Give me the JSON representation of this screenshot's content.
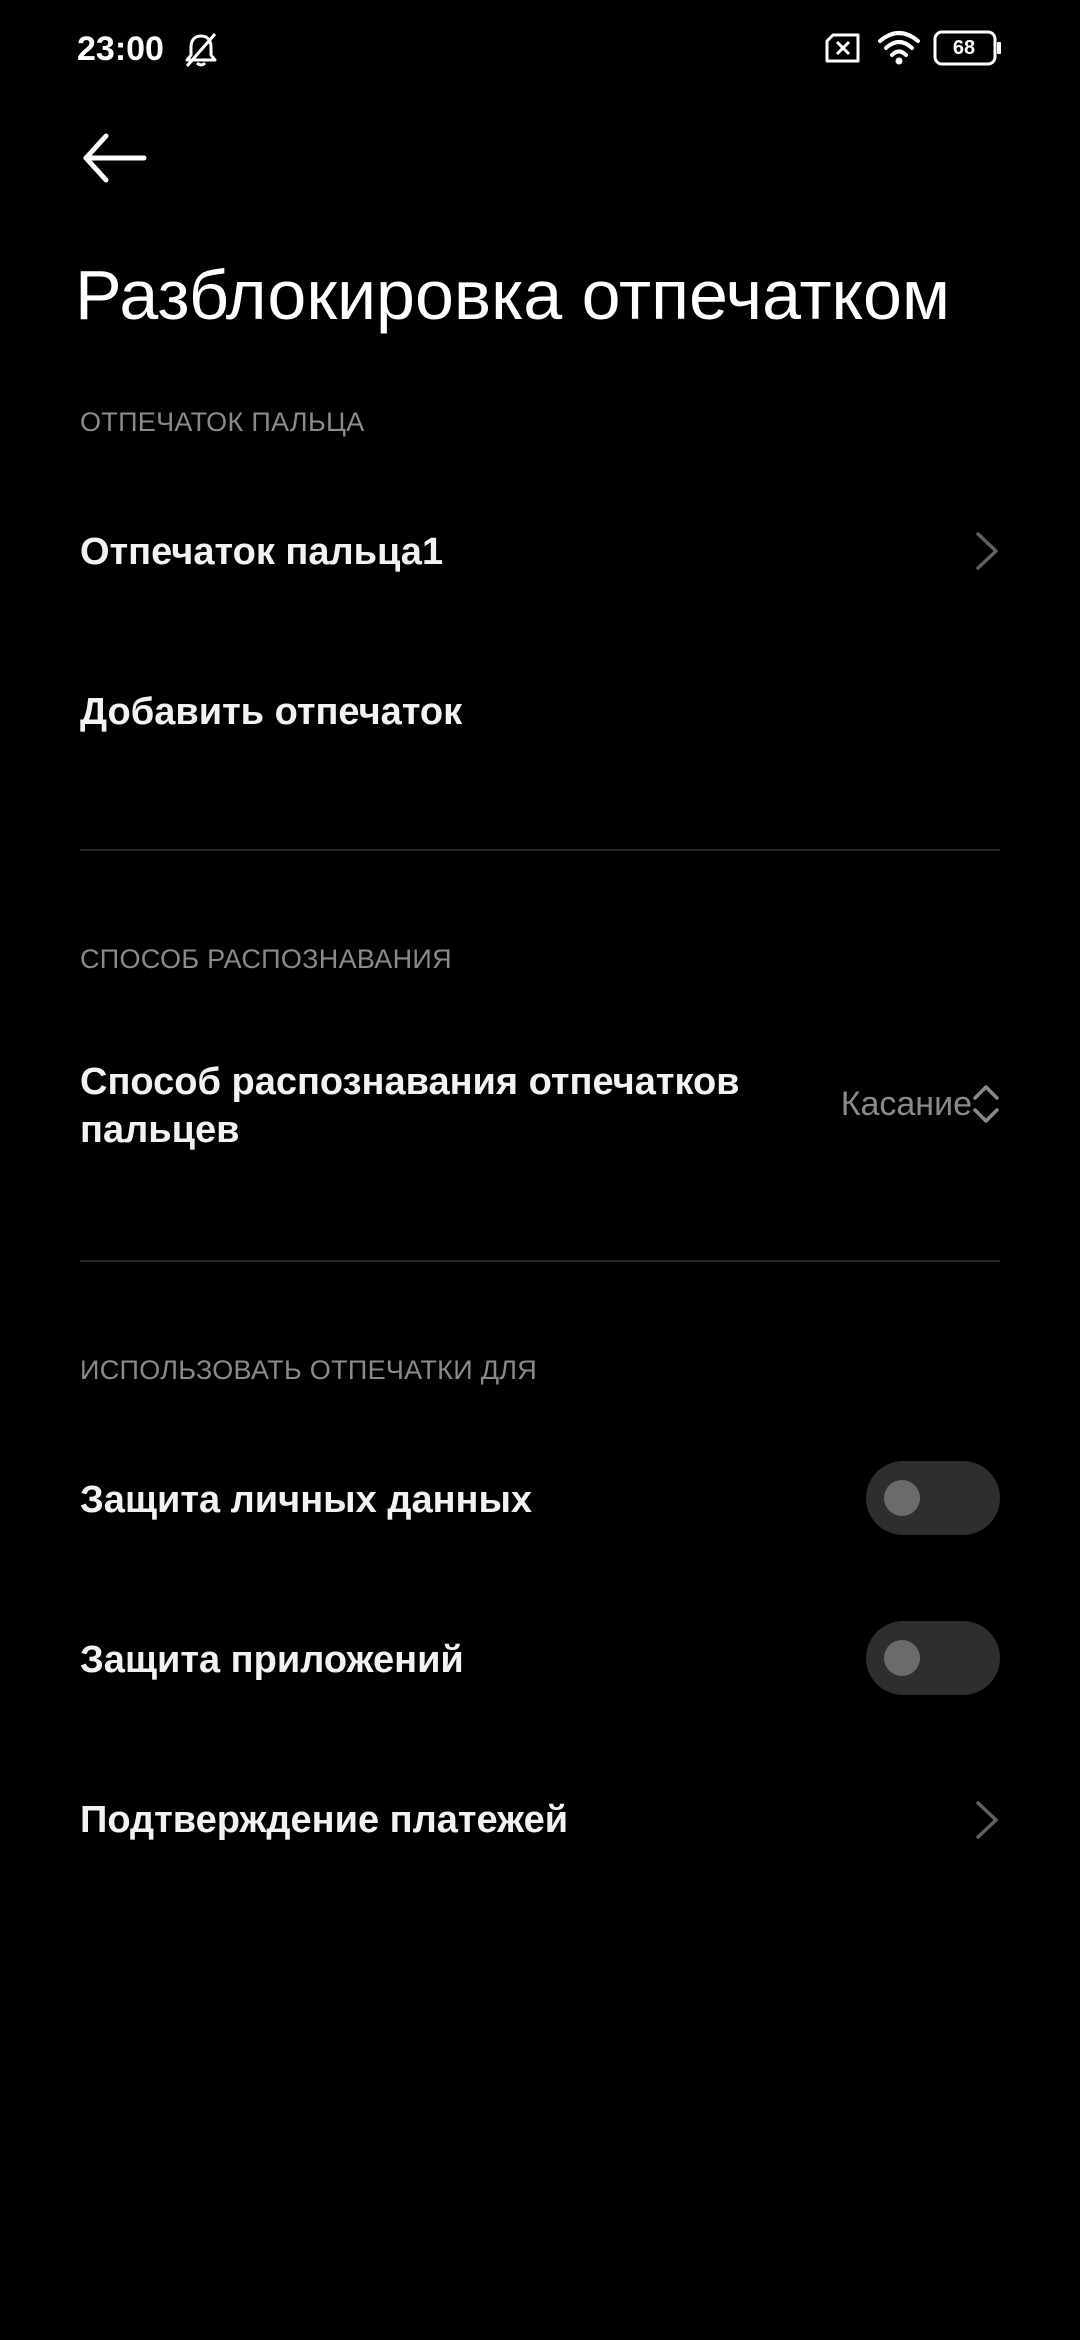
{
  "status_bar": {
    "time": "23:00",
    "battery": "68",
    "icons": [
      "bell-off-icon",
      "sim-x-icon",
      "wifi-icon",
      "battery-icon"
    ]
  },
  "header": {
    "back_icon": "arrow-left-icon",
    "title": "Разблокировка отпечатком"
  },
  "sections": {
    "fingerprint": {
      "header": "ОТПЕЧАТОК ПАЛЬЦА",
      "item_fingerprint1": "Отпечаток пальца1",
      "add_fingerprint": "Добавить отпечаток"
    },
    "recognition": {
      "header": "СПОСОБ РАСПОЗНАВАНИЯ",
      "method_label_line1": "Способ распознавания отпечатков",
      "method_label_line2": "пальцев",
      "method_value": "Касание"
    },
    "use_for": {
      "header": "ИСПОЛЬЗОВАТЬ ОТПЕЧАТКИ ДЛЯ",
      "privacy": "Защита личных данных",
      "privacy_enabled": false,
      "app_lock": "Защита приложений",
      "app_lock_enabled": false,
      "payments": "Подтверждение платежей"
    }
  },
  "colors": {
    "background": "#000000",
    "text_primary": "#f2f2f2",
    "text_secondary": "#8a8a8a",
    "toggle_track": "#2e2e2e",
    "toggle_knob": "#6b6b6b",
    "divider": "#262626"
  }
}
